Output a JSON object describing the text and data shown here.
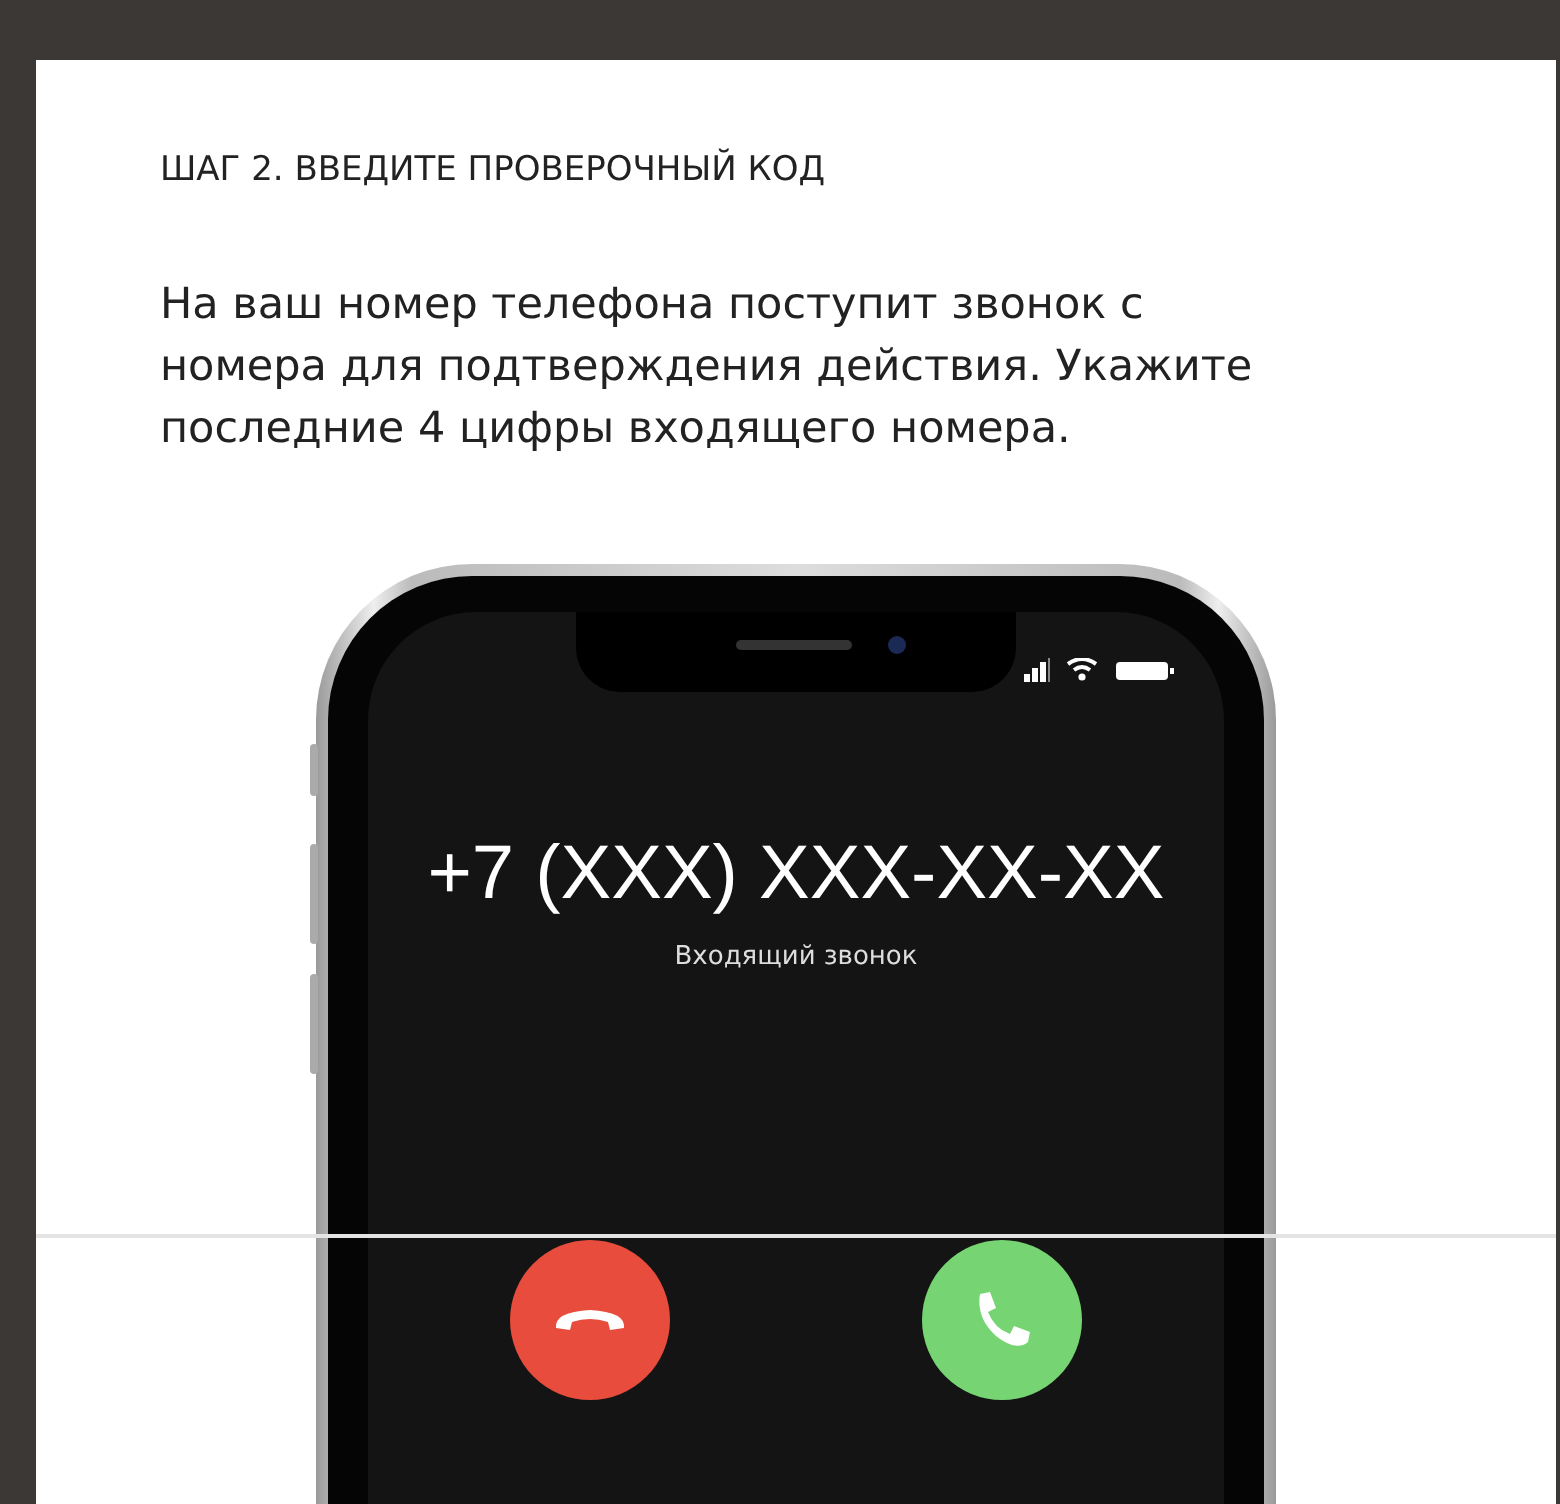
{
  "step_title": "ШАГ 2. ВВЕДИТЕ ПРОВЕРОЧНЫЙ КОД",
  "instructions": "На ваш номер телефона поступит звонок с номера для подтверждения действия. Укажите последние 4 цифры входящего номера.",
  "phone": {
    "caller_number": "+7 (XXX) XXX-XX-XX",
    "call_status": "Входящий звонок"
  }
}
